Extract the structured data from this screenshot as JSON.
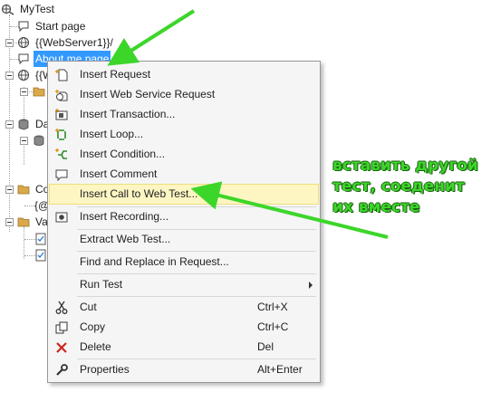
{
  "tree": {
    "root": "MyTest",
    "items": [
      {
        "label": "Start page",
        "icon": "comment-icon"
      },
      {
        "label": "{{WebServer1}}/",
        "icon": "globe-icon"
      },
      {
        "label": "About me page",
        "icon": "comment-icon",
        "selected": true
      },
      {
        "label": "{{W",
        "icon": "globe-icon"
      },
      {
        "label": "Da",
        "icon": "database-icon"
      },
      {
        "label": "Co",
        "icon": "folder-icon"
      },
      {
        "label": "{@",
        "icon": "folder-icon"
      },
      {
        "label": "Va",
        "icon": "folder-icon"
      }
    ]
  },
  "menu": {
    "items": [
      {
        "label": "Insert Request",
        "icon": "insert-request-icon"
      },
      {
        "label": "Insert Web Service Request",
        "icon": "web-service-request-icon"
      },
      {
        "label": "Insert Transaction...",
        "icon": "transaction-icon"
      },
      {
        "label": "Insert Loop...",
        "icon": "loop-icon"
      },
      {
        "label": "Insert Condition...",
        "icon": "condition-icon"
      },
      {
        "label": "Insert Comment",
        "icon": "comment-icon"
      },
      {
        "label": "Insert Call to Web Test...",
        "icon": "",
        "highlighted": true
      },
      {
        "label": "Insert Recording...",
        "icon": "recording-icon"
      },
      {
        "label": "Extract Web Test...",
        "icon": ""
      },
      {
        "label": "Find and Replace in Request...",
        "icon": ""
      },
      {
        "label": "Run Test",
        "icon": "",
        "submenu": true
      },
      {
        "label": "Cut",
        "icon": "scissors-icon",
        "shortcut": "Ctrl+X"
      },
      {
        "label": "Copy",
        "icon": "copy-icon",
        "shortcut": "Ctrl+C"
      },
      {
        "label": "Delete",
        "icon": "delete-x-icon",
        "shortcut": "Del",
        "icon_color": "#c8281e"
      },
      {
        "label": "Properties",
        "icon": "wrench-icon",
        "shortcut": "Alt+Enter"
      }
    ]
  },
  "annotation": {
    "lines": [
      "вставить другой",
      "тест, соеденит",
      "их вместе"
    ],
    "color": "#3cd62a"
  },
  "colors": {
    "selection": "#3399ff",
    "menu_highlight": "#fdf6c3",
    "menu_background": "#f5f5f5"
  }
}
